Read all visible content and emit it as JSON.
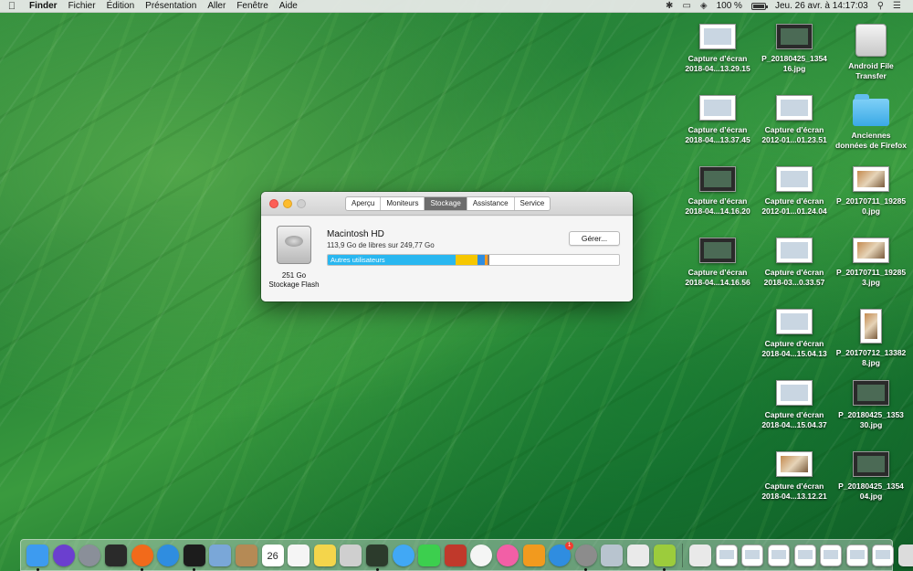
{
  "menubar": {
    "app": "Finder",
    "items": [
      "Fichier",
      "Édition",
      "Présentation",
      "Aller",
      "Fenêtre",
      "Aide"
    ],
    "battery": "100 %",
    "datetime": "Jeu. 26 avr. à  14:17:03"
  },
  "desktop": {
    "icons": [
      {
        "line1": "Capture d’écran",
        "line2": "2018-04...13.29.15",
        "type": "screenshot"
      },
      {
        "line1": "P_20180425_1354",
        "line2": "16.jpg",
        "type": "dark"
      },
      {
        "line1": "Android File",
        "line2": "Transfer",
        "type": "drive"
      },
      {
        "line1": "Capture d’écran",
        "line2": "2018-04...13.37.45",
        "type": "screenshot"
      },
      {
        "line1": "Capture d’écran",
        "line2": "2012-01...01.23.51",
        "type": "screenshot"
      },
      {
        "line1": "Anciennes",
        "line2": "données de Firefox",
        "type": "folder"
      },
      {
        "line1": "Capture d’écran",
        "line2": "2018-04...14.16.20",
        "type": "dark"
      },
      {
        "line1": "Capture d’écran",
        "line2": "2012-01...01.24.04",
        "type": "screenshot"
      },
      {
        "line1": "P_20170711_19285",
        "line2": "0.jpg",
        "type": "photo"
      },
      {
        "line1": "Capture d’écran",
        "line2": "2018-04...14.16.56",
        "type": "dark"
      },
      {
        "line1": "Capture d’écran",
        "line2": "2018-03...0.33.57",
        "type": "screenshot"
      },
      {
        "line1": "P_20170711_19285",
        "line2": "3.jpg",
        "type": "photo"
      },
      {
        "line1": "Capture d’écran",
        "line2": "2018-04...15.04.13",
        "type": "screenshot"
      },
      {
        "line1": "P_20170712_13382",
        "line2": "8.jpg",
        "type": "tall"
      },
      {
        "line1": "Capture d’écran",
        "line2": "2018-04...15.04.37",
        "type": "screenshot"
      },
      {
        "line1": "P_20180425_1353",
        "line2": "30.jpg",
        "type": "dark"
      },
      {
        "line1": "Capture d’écran",
        "line2": "2018-04...13.12.21",
        "type": "photo"
      },
      {
        "line1": "P_20180425_1354",
        "line2": "04.jpg",
        "type": "dark"
      }
    ]
  },
  "window": {
    "tabs": [
      "Aperçu",
      "Moniteurs",
      "Stockage",
      "Assistance",
      "Service"
    ],
    "active_tab": "Stockage",
    "disk_name": "Macintosh HD",
    "free_space": "113,9 Go de libres sur 249,77 Go",
    "capacity": "251 Go",
    "storage_type": "Stockage Flash",
    "manage_button": "Gérer...",
    "usage": {
      "segments": [
        {
          "label": "Autres utilisateurs",
          "fraction": 0.44,
          "color": "#29b7f0"
        },
        {
          "label": "",
          "fraction": 0.075,
          "color": "#f6c700"
        },
        {
          "label": "",
          "fraction": 0.025,
          "color": "#2f8de0"
        },
        {
          "label": "",
          "fraction": 0.008,
          "color": "#ff9a1e"
        },
        {
          "label": "",
          "fraction": 0.006,
          "color": "#7b7b7b"
        }
      ]
    }
  },
  "dock": {
    "apps": [
      {
        "name": "finder",
        "color": "#3d9bf0",
        "running": true
      },
      {
        "name": "siri",
        "color": "#6b3fcf",
        "running": false
      },
      {
        "name": "launchpad",
        "color": "#8a8f99",
        "running": false
      },
      {
        "name": "mission-control",
        "color": "#2a2a2a",
        "running": false
      },
      {
        "name": "firefox",
        "color": "#f26a1b",
        "running": true
      },
      {
        "name": "safari",
        "color": "#2f8de0",
        "running": false
      },
      {
        "name": "terminal",
        "color": "#1c1c1c",
        "running": true
      },
      {
        "name": "preview",
        "color": "#7aa7d8",
        "running": false
      },
      {
        "name": "contacts",
        "color": "#b58a55",
        "running": false
      },
      {
        "name": "calendar",
        "color": "#ffffff",
        "running": false,
        "label": "26"
      },
      {
        "name": "reminders",
        "color": "#f5f5f5",
        "running": false
      },
      {
        "name": "notes",
        "color": "#f4d54b",
        "running": false
      },
      {
        "name": "photo-booth",
        "color": "#cfcfcf",
        "running": false
      },
      {
        "name": "activity-monitor",
        "color": "#2c3b2c",
        "running": true
      },
      {
        "name": "messages",
        "color": "#41a8f5",
        "running": false
      },
      {
        "name": "facetime",
        "color": "#3ccf4e",
        "running": false
      },
      {
        "name": "photo-booth-2",
        "color": "#c0392b",
        "running": false
      },
      {
        "name": "photos",
        "color": "#f5f5f5",
        "running": false
      },
      {
        "name": "itunes",
        "color": "#f25fa6",
        "running": false
      },
      {
        "name": "ibooks",
        "color": "#f29a1e",
        "running": false
      },
      {
        "name": "app-store",
        "color": "#2f8de0",
        "running": false,
        "badge": "1"
      },
      {
        "name": "system-preferences",
        "color": "#8c8c8c",
        "running": true
      },
      {
        "name": "image-capture",
        "color": "#b8c4cf",
        "running": false
      },
      {
        "name": "script-editor",
        "color": "#eaeaea",
        "running": false
      },
      {
        "name": "android-file-transfer",
        "color": "#9ccc3c",
        "running": true
      }
    ],
    "docs": [
      {
        "name": "disk-utility",
        "color": "#e9e9e9"
      },
      {
        "name": "recent-doc-1",
        "color": "#ffffff"
      },
      {
        "name": "recent-doc-2",
        "color": "#ffffff"
      },
      {
        "name": "recent-doc-3",
        "color": "#ffffff"
      },
      {
        "name": "recent-doc-4",
        "color": "#ffffff"
      },
      {
        "name": "recent-doc-5",
        "color": "#ffffff"
      },
      {
        "name": "recent-doc-6",
        "color": "#ffffff"
      },
      {
        "name": "recent-doc-7",
        "color": "#ffffff"
      },
      {
        "name": "trash",
        "color": "#dcdcdc"
      }
    ]
  }
}
